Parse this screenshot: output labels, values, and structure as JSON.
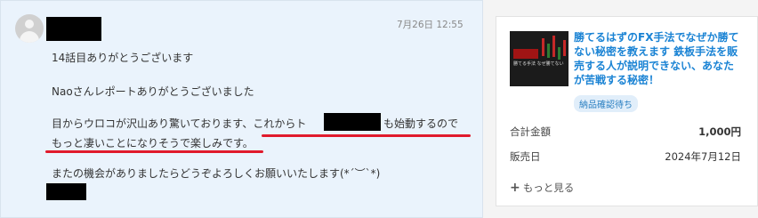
{
  "message": {
    "timestamp": "7月26日 12:55",
    "line1": "14話目ありがとうございます",
    "line2": "Naoさんレポートありがとうございました",
    "line3a": "目からウロコが沢山あり驚いております、これからト",
    "line3b": "も始動するので",
    "line4": "もっと凄いことになりそうで楽しみです。",
    "line5": "またの機会がありましたらどうぞよろしくお願いいたします(*´︶`*)",
    "colors": {
      "underline": "#e01a2c",
      "panel": "#eaf3fc"
    }
  },
  "order": {
    "product_title": "勝てるはずのFX手法でなぜか勝てない秘密を教えます 鉄板手法を販売する人が説明できない、あなたが苦戦する秘密！",
    "status_badge": "納品確認待ち",
    "total_label": "合計金額",
    "total_value": "1,000円",
    "sale_date_label": "販売日",
    "sale_date_value": "2024年7月12日",
    "more_label": "もっと見る",
    "thumbnail_text": "勝てる手法 なぜ勝てない",
    "colors": {
      "title": "#1a83d4",
      "badge_bg": "#e1eefa"
    }
  }
}
